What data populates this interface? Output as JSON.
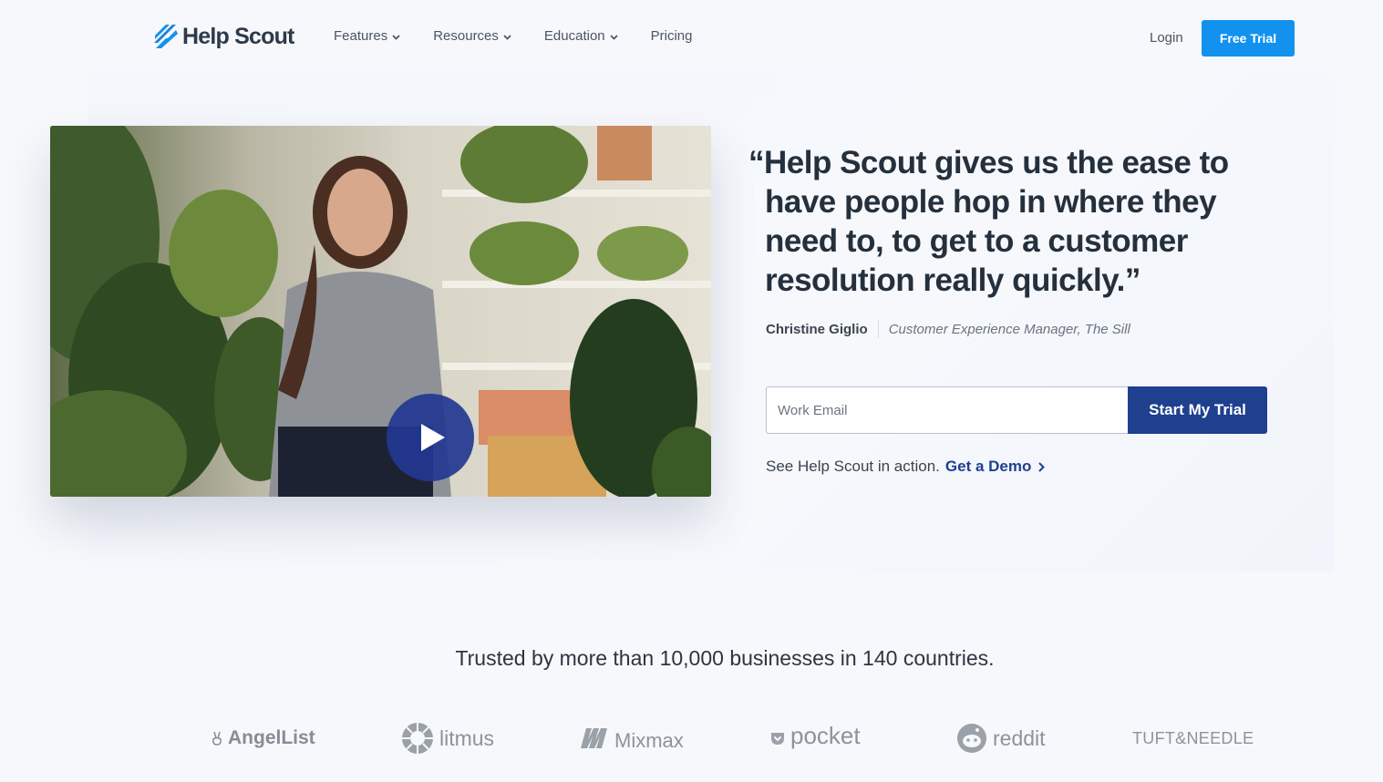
{
  "nav": {
    "logo_text": "Help Scout",
    "links": [
      {
        "label": "Features",
        "has_dropdown": true
      },
      {
        "label": "Resources",
        "has_dropdown": true
      },
      {
        "label": "Education",
        "has_dropdown": true
      },
      {
        "label": "Pricing",
        "has_dropdown": false
      }
    ],
    "login_label": "Login",
    "free_trial_label": "Free Trial"
  },
  "hero": {
    "video": {
      "play_icon": "play-icon"
    },
    "quote": "“Help Scout gives us the ease to have people hop in where they need to, to get to a customer resolution really quickly.”",
    "author_name": "Christine Giglio",
    "author_role": "Customer Experience Manager, The Sill",
    "email_placeholder": "Work Email",
    "start_button_label": "Start My Trial",
    "demo_prefix": "See Help Scout in action.",
    "demo_link_label": "Get a Demo"
  },
  "trusted": {
    "headline": "Trusted by more than 10,000 businesses in 140 countries.",
    "logos": [
      "AngelList",
      "litmus",
      "Mixmax",
      "pocket",
      "reddit",
      "TUFT&NEEDLE"
    ]
  },
  "colors": {
    "brand_blue": "#1292ee",
    "cta_navy": "#1f3f8f",
    "page_bg": "#f6f8fb"
  }
}
